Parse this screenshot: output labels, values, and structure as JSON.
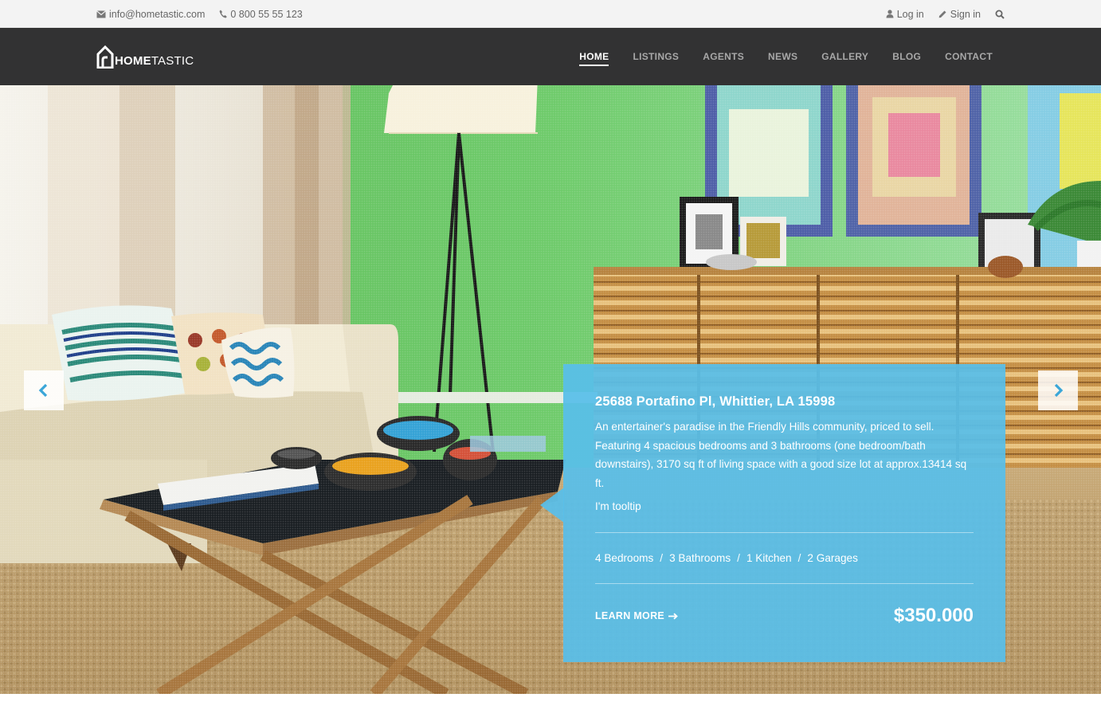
{
  "topbar": {
    "email": "info@hometastic.com",
    "phone": "0 800 55 55 123",
    "login": "Log in",
    "signin": "Sign in"
  },
  "brand": {
    "logo_bold": "HOME",
    "logo_rest": "TASTIC"
  },
  "nav": {
    "items": [
      "HOME",
      "LISTINGS",
      "AGENTS",
      "NEWS",
      "GALLERY",
      "BLOG",
      "CONTACT"
    ],
    "active": "HOME"
  },
  "listing": {
    "address": "25688 Portafino Pl, Whittier, LA 15998",
    "description": "An entertainer's paradise in the Friendly Hills community, priced to sell. Featuring 4 spacious bedrooms and 3 bathrooms (one bedroom/bath downstairs), 3170 sq ft of living space with a good size lot at approx.13414 sq ft.",
    "tooltip": "I'm tooltip",
    "features": [
      "4 Bedrooms",
      "3 Bathrooms",
      "1 Kitchen",
      "2 Garages"
    ],
    "feature_separator": "/",
    "cta": "LEARN MORE",
    "price": "$350.000"
  },
  "colors": {
    "topbar_bg": "#f3f3f3",
    "nav_bg": "#323233",
    "card_bg": "#58beea",
    "wall_green": "#6cc36a"
  }
}
